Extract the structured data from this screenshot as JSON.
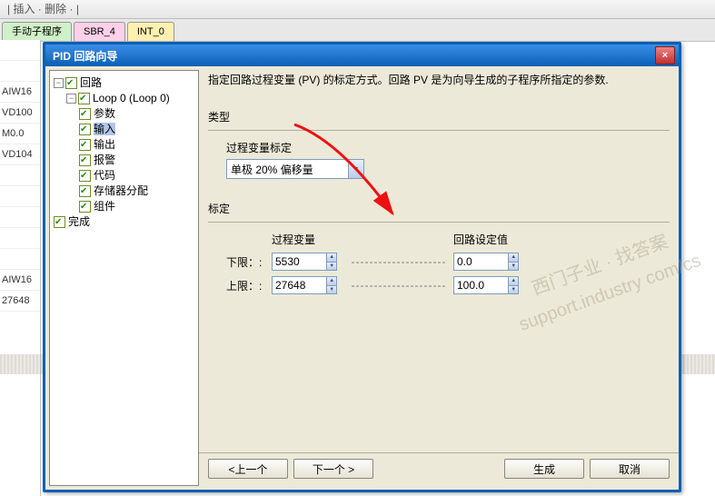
{
  "topbar": {
    "insert": "插入",
    "delete": "删除"
  },
  "tabs": {
    "a": "手动子程序",
    "b": "SBR_4",
    "c": "INT_0"
  },
  "leftcells": [
    "",
    "",
    "AIW16",
    "VD100",
    "M0.0",
    "VD104",
    "",
    "",
    "",
    "",
    "",
    "AIW16",
    "27648"
  ],
  "dialog": {
    "title": "PID 回路向导",
    "close": "×",
    "description": "指定回路过程变量 (PV) 的标定方式。回路 PV 是为向导生成的子程序所指定的参数.",
    "tree": {
      "root": "回路",
      "loop": "Loop 0 (Loop 0)",
      "items": [
        "参数",
        "输入",
        "输出",
        "报警",
        "代码",
        "存储器分配",
        "组件"
      ],
      "done": "完成"
    },
    "type": {
      "header": "类型",
      "pv_label": "过程变量标定",
      "pv_value": "单极 20% 偏移量"
    },
    "scale": {
      "header": "标定",
      "pv_col": "过程变量",
      "sp_col": "回路设定值",
      "low_label": "下限：:",
      "high_label": "上限：:",
      "pv_low": "5530",
      "pv_high": "27648",
      "sp_low": "0.0",
      "sp_high": "100.0"
    },
    "buttons": {
      "prev": "<上一个",
      "next": "下一个 >",
      "generate": "生成",
      "cancel": "取消"
    }
  },
  "watermark": {
    "l1": "西门子业 · 找答案",
    "l2": "support.industry com/cs"
  }
}
